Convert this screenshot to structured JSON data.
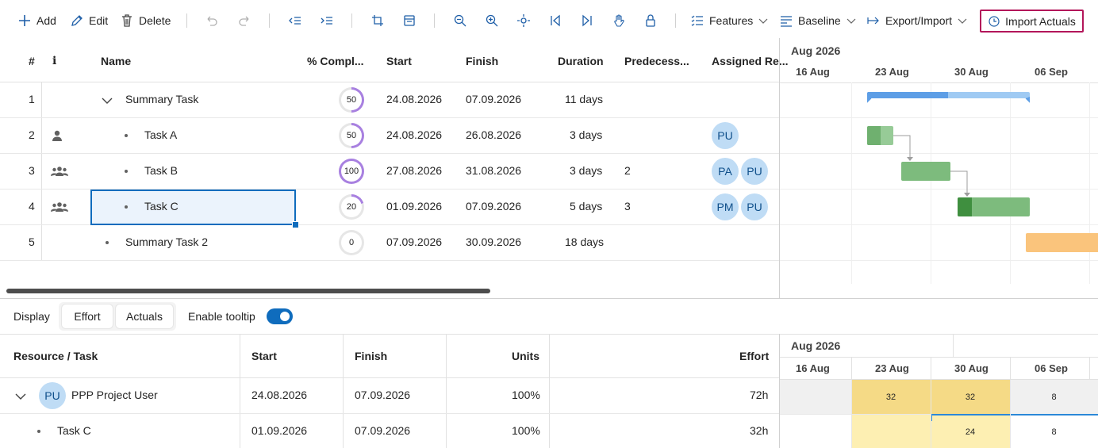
{
  "toolbar": {
    "add_label": "Add",
    "edit_label": "Edit",
    "delete_label": "Delete",
    "features_label": "Features",
    "baseline_label": "Baseline",
    "export_import_label": "Export/Import",
    "import_actuals_label": "Import Actuals"
  },
  "grid": {
    "columns": [
      "#",
      "i",
      "Name",
      "% Compl...",
      "Start",
      "Finish",
      "Duration",
      "Predecess...",
      "Assigned Re..."
    ],
    "rows": [
      {
        "num": "1",
        "name": "Summary Task",
        "percent": 50,
        "start": "24.08.2026",
        "finish": "07.09.2026",
        "duration": "11 days",
        "pred": "",
        "assigned": []
      },
      {
        "num": "2",
        "name": "Task A",
        "percent": 50,
        "start": "24.08.2026",
        "finish": "26.08.2026",
        "duration": "3 days",
        "pred": "",
        "assigned": [
          "PU"
        ]
      },
      {
        "num": "3",
        "name": "Task B",
        "percent": 100,
        "start": "27.08.2026",
        "finish": "31.08.2026",
        "duration": "3 days",
        "pred": "2",
        "assigned": [
          "PA",
          "PU"
        ]
      },
      {
        "num": "4",
        "name": "Task C",
        "percent": 20,
        "start": "01.09.2026",
        "finish": "07.09.2026",
        "duration": "5 days",
        "pred": "3",
        "assigned": [
          "PM",
          "PU"
        ]
      },
      {
        "num": "5",
        "name": "Summary Task 2",
        "percent": 0,
        "start": "07.09.2026",
        "finish": "30.09.2026",
        "duration": "18 days",
        "pred": "",
        "assigned": []
      }
    ]
  },
  "gantt": {
    "month": "Aug 2026",
    "weeks": [
      "16 Aug",
      "23 Aug",
      "30 Aug",
      "06 Sep"
    ]
  },
  "bottom": {
    "display_label": "Display",
    "effort_tab": "Effort",
    "actuals_tab": "Actuals",
    "tooltip_label": "Enable tooltip",
    "tooltip_enabled": true,
    "columns": [
      "Resource / Task",
      "Start",
      "Finish",
      "Units",
      "Effort"
    ],
    "rows": [
      {
        "avatar": "PU",
        "name": "PPP Project User",
        "start": "24.08.2026",
        "finish": "07.09.2026",
        "units": "100%",
        "effort": "72h"
      },
      {
        "avatar": "",
        "name": "Task C",
        "start": "01.09.2026",
        "finish": "07.09.2026",
        "units": "100%",
        "effort": "32h"
      }
    ],
    "gantt_month": "Aug 2026",
    "gantt_weeks": [
      "16 Aug",
      "23 Aug",
      "30 Aug",
      "06 Sep"
    ],
    "resource_values": [
      "32",
      "32",
      "8"
    ],
    "task_values": [
      "24",
      "8"
    ]
  },
  "colors": {
    "accent": "#0f6cbd",
    "highlight_border": "#b3165a",
    "summary_bar": "#6aa8e8",
    "task_bar": "#7dbb7d",
    "summary2_bar": "#fac47c",
    "effort_yellow": "#f5da86"
  }
}
